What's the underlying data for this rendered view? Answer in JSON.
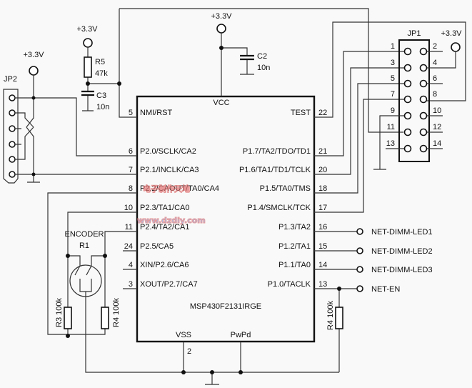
{
  "chip": {
    "part": "MSP430F2131IRGE",
    "vcc": "VCC",
    "vss": "VSS",
    "pwpd": "PwPd",
    "vss_pin": "2",
    "left_pins": [
      {
        "num": "5",
        "name": "NMI/RST"
      },
      {
        "num": "6",
        "name": "P2.0/SCLK/CA2"
      },
      {
        "num": "7",
        "name": "P2.1/INCLK/CA3"
      },
      {
        "num": "8",
        "name": "P2.2/CAOUT/TA0/CA4"
      },
      {
        "num": "10",
        "name": "P2.3/TA1/CA0"
      },
      {
        "num": "11",
        "name": "P2.4/TA2/CA1"
      },
      {
        "num": "24",
        "name": "P2.5/CA5"
      },
      {
        "num": "4",
        "name": "XIN/P2.6/CA6"
      },
      {
        "num": "3",
        "name": "XOUT/P2.7/CA7"
      }
    ],
    "right_pins": [
      {
        "num": "22",
        "name": "TEST"
      },
      {
        "num": "21",
        "name": "P1.7/TA2/TDO/TD1"
      },
      {
        "num": "20",
        "name": "P1.6/TA1/TD1/TCLK"
      },
      {
        "num": "18",
        "name": "P1.5/TA0/TMS"
      },
      {
        "num": "17",
        "name": "P1.4/SMCLK/TCK"
      },
      {
        "num": "16",
        "name": "P1.3/TA2"
      },
      {
        "num": "15",
        "name": "P1.2/TA1"
      },
      {
        "num": "14",
        "name": "P1.1/TA0"
      },
      {
        "num": "13",
        "name": "P1.0/TACLK"
      }
    ]
  },
  "nets": [
    "NET-DIMM-LED1",
    "NET-DIMM-LED2",
    "NET-DIMM-LED3",
    "NET-EN"
  ],
  "power": {
    "label": "+3.3V"
  },
  "components": {
    "r5": {
      "ref": "R5",
      "value": "47k"
    },
    "c3": {
      "ref": "C3",
      "value": "10n"
    },
    "c2": {
      "ref": "C2",
      "value": "10n"
    },
    "encoder": {
      "title": "ENCODER",
      "ref": "R1"
    },
    "r3": {
      "label": "R3 100k"
    },
    "r4": {
      "label": "R4 100k"
    },
    "r4b": {
      "label": "R4 100k"
    }
  },
  "jp1": {
    "ref": "JP1",
    "left": [
      "1",
      "3",
      "5",
      "7",
      "9",
      "11",
      "13"
    ],
    "right": [
      "2",
      "4",
      "6",
      "8",
      "10",
      "12",
      "14"
    ]
  },
  "jp2": {
    "ref": "JP2"
  },
  "watermark": {
    "cn": "电子制作天地",
    "url": "www.dzdiy.com"
  }
}
